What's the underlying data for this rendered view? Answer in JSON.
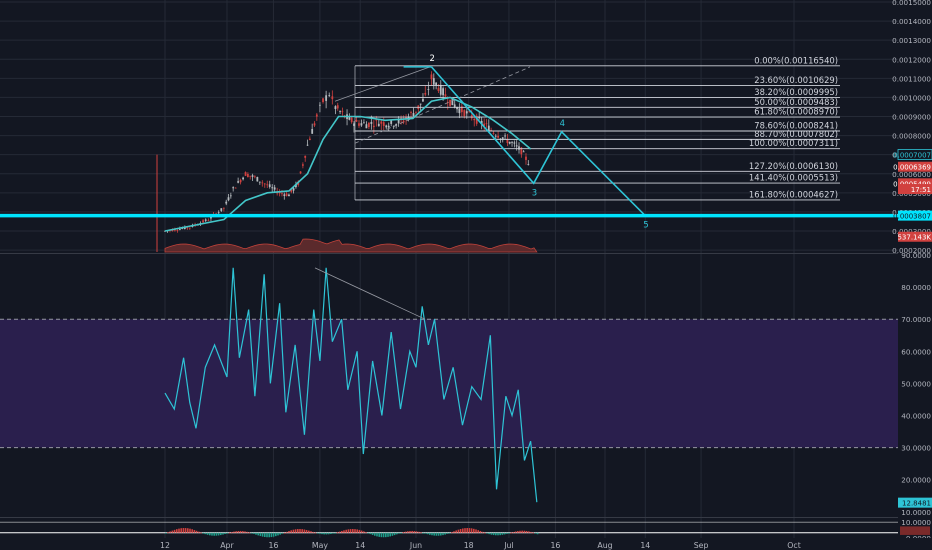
{
  "colors": {
    "background": "#131722",
    "grid": "#252a36",
    "text": "#d1d4dc",
    "wave": "#2ec4d6",
    "fib": "#d1d4dc",
    "rsi": "#2ec4d6",
    "rsi_band": "#2a1f4d",
    "candle_up": "#b6bbbf",
    "candle_down": "#d1413f",
    "ema": "#43c6c9",
    "volume": "#c0423a",
    "price_tag": "#d1413f",
    "support": "#00e5ff",
    "macd_up": "#d1413f",
    "macd_down": "#1f9e8b"
  },
  "chart_data": [
    {
      "type": "candlestick",
      "pane": "price",
      "x_ticks": [
        "12",
        "Apr",
        "16",
        "May",
        "14",
        "Jun",
        "18",
        "Jul",
        "16",
        "Aug",
        "14",
        "Sep",
        "Oct"
      ],
      "y_ticks": [
        "0.0015000",
        "0.0014000",
        "0.0013000",
        "0.0012000",
        "0.0011000",
        "0.0010000",
        "0.0009000",
        "0.0008000",
        "0.0007000",
        "0.0006000",
        "0.0005000",
        "0.0004000",
        "0.0003000",
        "0.0002000"
      ],
      "ylim": [
        0.00019,
        0.0015
      ],
      "series_close": [
        [
          "Mar 12",
          0.0003
        ],
        [
          "Mar 20",
          0.00032
        ],
        [
          "Mar 26",
          0.00036
        ],
        [
          "Mar 31",
          0.00042
        ],
        [
          "Apr 3",
          0.00052
        ],
        [
          "Apr 7",
          0.0006
        ],
        [
          "Apr 10",
          0.00058
        ],
        [
          "Apr 14",
          0.00054
        ],
        [
          "Apr 18",
          0.0005
        ],
        [
          "Apr 21",
          0.00049
        ],
        [
          "Apr 24",
          0.00055
        ],
        [
          "Apr 27",
          0.00075
        ],
        [
          "Apr 30",
          0.0009
        ],
        [
          "May 2",
          0.00098
        ],
        [
          "May 4",
          0.00102
        ],
        [
          "May 6",
          0.00095
        ],
        [
          "May 9",
          0.0009
        ],
        [
          "May 12",
          0.00087
        ],
        [
          "May 16",
          0.00086
        ],
        [
          "May 20",
          0.00087
        ],
        [
          "May 24",
          0.00086
        ],
        [
          "May 28",
          0.00088
        ],
        [
          "Jun 1",
          0.00093
        ],
        [
          "Jun 4",
          0.001
        ],
        [
          "Jun 6",
          0.0011
        ],
        [
          "Jun 9",
          0.00104
        ],
        [
          "Jun 12",
          0.00098
        ],
        [
          "Jun 15",
          0.00094
        ],
        [
          "Jun 19",
          0.0009
        ],
        [
          "Jun 23",
          0.00086
        ],
        [
          "Jun 26",
          0.00082
        ],
        [
          "Jun 29",
          0.00079
        ],
        [
          "Jul 2",
          0.00076
        ],
        [
          "Jul 5",
          0.00072
        ],
        [
          "Jul 8",
          0.00064
        ]
      ],
      "ema_line": [
        [
          "Mar 12",
          0.0003
        ],
        [
          "Mar 31",
          0.00036
        ],
        [
          "Apr 7",
          0.00046
        ],
        [
          "Apr 14",
          0.0005
        ],
        [
          "Apr 21",
          0.00051
        ],
        [
          "Apr 27",
          0.0006
        ],
        [
          "May 2",
          0.00078
        ],
        [
          "May 7",
          0.0009
        ],
        [
          "May 14",
          0.0009
        ],
        [
          "May 22",
          0.00088
        ],
        [
          "May 31",
          0.00089
        ],
        [
          "Jun 6",
          0.00098
        ],
        [
          "Jun 12",
          0.001
        ],
        [
          "Jun 19",
          0.00095
        ],
        [
          "Jun 26",
          0.00088
        ],
        [
          "Jul 2",
          0.00081
        ],
        [
          "Jul 8",
          0.00073
        ]
      ],
      "fibonacci_levels": [
        {
          "label": "0.00%(0.00116540)",
          "value": 0.0011654
        },
        {
          "label": "23.60%(0.0010629)",
          "value": 0.0010629
        },
        {
          "label": "38.20%(0.0009995)",
          "value": 0.0009995
        },
        {
          "label": "50.00%(0.0009483)",
          "value": 0.0009483
        },
        {
          "label": "61.80%(0.0008970)",
          "value": 0.000897
        },
        {
          "label": "78.60%(0.0008241)",
          "value": 0.0008241
        },
        {
          "label": "88.70%(0.0007802)",
          "value": 0.0007802
        },
        {
          "label": "100.00%(0.0007311)",
          "value": 0.0007311
        },
        {
          "label": "127.20%(0.0006130)",
          "value": 0.000613
        },
        {
          "label": "141.40%(0.0005513)",
          "value": 0.0005513
        },
        {
          "label": "161.80%(0.0004627)",
          "value": 0.0004627
        }
      ],
      "wave_projection": [
        {
          "label": "2",
          "date": "Jun 6",
          "value": 0.00116
        },
        {
          "label": "3",
          "date": "Jul 9",
          "value": 0.00055
        },
        {
          "label": "4",
          "date": "Jul 18",
          "value": 0.00082
        },
        {
          "label": "5",
          "date": "Aug 14",
          "value": 0.00038
        }
      ],
      "support_level": 0.0003807,
      "price_tags": [
        {
          "label": "0.0007007",
          "value": 0.0007007,
          "style": "outline"
        },
        {
          "label": "0.0006369",
          "value": 0.0006369,
          "style": "red"
        },
        {
          "label": "0.0005499",
          "value": 0.0005499,
          "style": "red"
        },
        {
          "label": "17:51",
          "value": 0.00052,
          "style": "red-small"
        },
        {
          "label": "0.0003807",
          "value": 0.0003807,
          "style": "cyan"
        },
        {
          "label": "537.143K",
          "value": 0.00027,
          "style": "red-small"
        }
      ]
    },
    {
      "type": "line",
      "pane": "rsi",
      "y_ticks": [
        "90.0000",
        "80.0000",
        "70.0000",
        "60.0000",
        "50.0000",
        "40.0000",
        "30.0000",
        "20.0000",
        "10.0000"
      ],
      "ylim": [
        9,
        90
      ],
      "band": [
        30,
        70
      ],
      "last_value_label": "12.8481",
      "values": [
        [
          "Mar 12",
          47
        ],
        [
          "Mar 15",
          42
        ],
        [
          "Mar 18",
          58
        ],
        [
          "Mar 20",
          44
        ],
        [
          "Mar 22",
          36
        ],
        [
          "Mar 25",
          55
        ],
        [
          "Mar 28",
          62
        ],
        [
          "Apr 1",
          52
        ],
        [
          "Apr 3",
          86
        ],
        [
          "Apr 5",
          58
        ],
        [
          "Apr 8",
          73
        ],
        [
          "Apr 10",
          46
        ],
        [
          "Apr 13",
          84
        ],
        [
          "Apr 15",
          50
        ],
        [
          "Apr 18",
          75
        ],
        [
          "Apr 20",
          41
        ],
        [
          "Apr 23",
          62
        ],
        [
          "Apr 26",
          34
        ],
        [
          "Apr 29",
          73
        ],
        [
          "May 1",
          57
        ],
        [
          "May 3",
          86
        ],
        [
          "May 5",
          63
        ],
        [
          "May 8",
          70
        ],
        [
          "May 10",
          48
        ],
        [
          "May 13",
          60
        ],
        [
          "May 15",
          28
        ],
        [
          "May 18",
          57
        ],
        [
          "May 21",
          40
        ],
        [
          "May 24",
          66
        ],
        [
          "May 27",
          42
        ],
        [
          "May 30",
          60
        ],
        [
          "Jun 1",
          55
        ],
        [
          "Jun 3",
          74
        ],
        [
          "Jun 5",
          62
        ],
        [
          "Jun 7",
          70
        ],
        [
          "Jun 10",
          45
        ],
        [
          "Jun 13",
          55
        ],
        [
          "Jun 16",
          37
        ],
        [
          "Jun 19",
          49
        ],
        [
          "Jun 22",
          45
        ],
        [
          "Jun 25",
          65
        ],
        [
          "Jun 27",
          17
        ],
        [
          "Jun 30",
          46
        ],
        [
          "Jul 2",
          40
        ],
        [
          "Jul 4",
          48
        ],
        [
          "Jul 6",
          26
        ],
        [
          "Jul 8",
          32
        ],
        [
          "Jul 10",
          13
        ]
      ]
    },
    {
      "type": "bar",
      "pane": "macd",
      "y_ticks": [
        "10.0000",
        "-0.0000"
      ],
      "ylim": [
        -3,
        12
      ]
    }
  ],
  "labels": {
    "legend_wave": [
      "2",
      "3",
      "4",
      "5"
    ]
  }
}
